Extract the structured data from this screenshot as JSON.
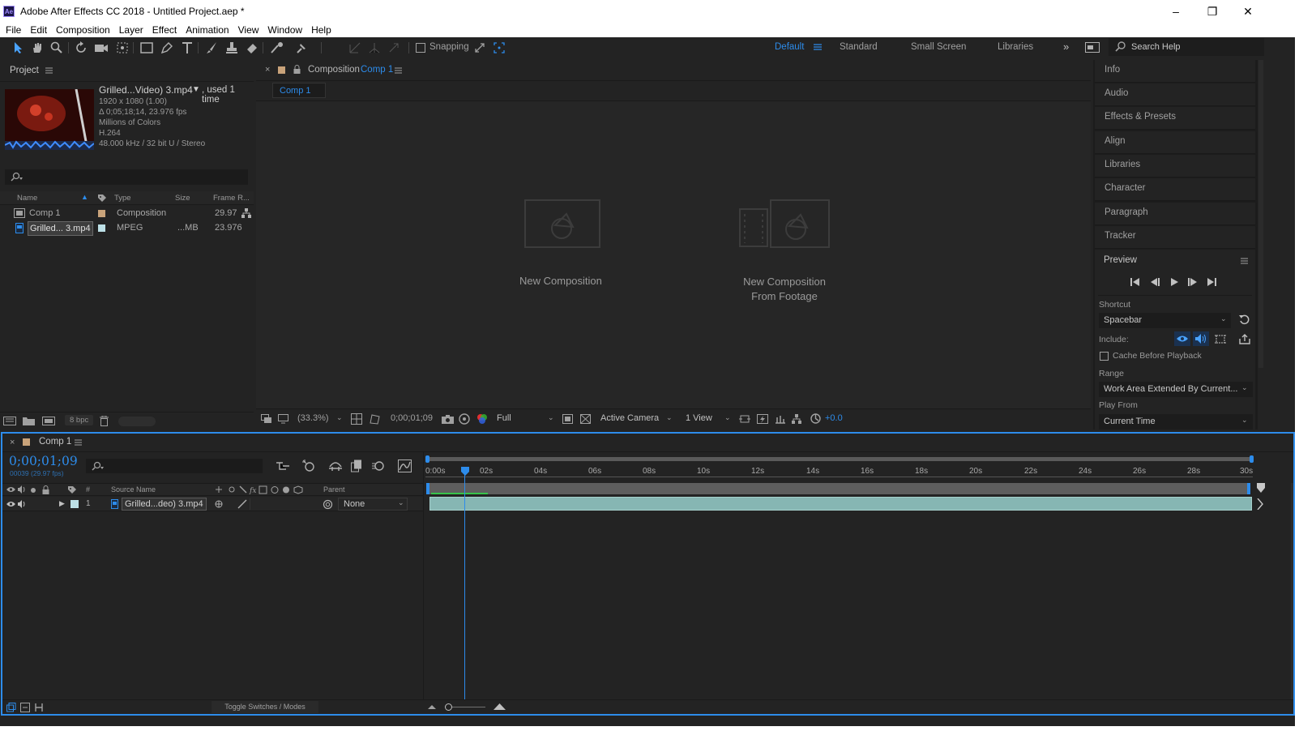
{
  "window": {
    "title": "Adobe After Effects CC 2018 - Untitled Project.aep *",
    "app_badge": "Ae"
  },
  "menu": [
    "File",
    "Edit",
    "Composition",
    "Layer",
    "Effect",
    "Animation",
    "View",
    "Window",
    "Help"
  ],
  "toolbar": {
    "snapping_label": "Snapping",
    "workspaces": [
      "Default",
      "Standard",
      "Small Screen",
      "Libraries"
    ],
    "search_placeholder": "Search Help"
  },
  "project": {
    "tab_label": "Project",
    "footage": {
      "name": "Grilled...Video) 3.mp4",
      "used": ", used 1 time",
      "meta": [
        "1920 x 1080 (1.00)",
        "Δ 0;05;18;14, 23.976 fps",
        "Millions of Colors",
        "H.264",
        "48.000 kHz / 32 bit U / Stereo"
      ]
    },
    "columns": [
      "Name",
      "Type",
      "Size",
      "Frame R..."
    ],
    "items": [
      {
        "name": "Comp 1",
        "type": "Composition",
        "size": "",
        "fps": "29.97"
      },
      {
        "name": "Grilled... 3.mp4",
        "type": "MPEG",
        "size": "...MB",
        "fps": "23.976"
      }
    ],
    "bpc": "8 bpc"
  },
  "viewer": {
    "tab_prefix": "Composition",
    "tab_name": "Comp 1",
    "subtab": "Comp 1",
    "new_comp": "New Composition",
    "new_comp_footage_1": "New Composition",
    "new_comp_footage_2": "From Footage",
    "zoom": "(33.3%)",
    "timecode": "0;00;01;09",
    "resolution": "Full",
    "camera": "Active Camera",
    "views": "1 View",
    "exposure": "+0.0"
  },
  "right_panels": [
    "Info",
    "Audio",
    "Effects & Presets",
    "Align",
    "Libraries",
    "Character",
    "Paragraph",
    "Tracker"
  ],
  "preview": {
    "title": "Preview",
    "shortcut_label": "Shortcut",
    "shortcut_value": "Spacebar",
    "include_label": "Include:",
    "cache_label": "Cache Before Playback",
    "range_label": "Range",
    "range_value": "Work Area Extended By Current...",
    "play_from_label": "Play From",
    "play_from_value": "Current Time"
  },
  "timeline": {
    "tab": "Comp 1",
    "timecode": "0;00;01;09",
    "frame_info": "00039 (29.97 fps)",
    "columns": [
      "#",
      "Source Name",
      "Parent"
    ],
    "layer": {
      "num": "1",
      "name": "Grilled...deo) 3.mp4",
      "parent": "None"
    },
    "ruler": [
      "0:00s",
      "02s",
      "04s",
      "06s",
      "08s",
      "10s",
      "12s",
      "14s",
      "16s",
      "18s",
      "20s",
      "22s",
      "24s",
      "26s",
      "28s",
      "30s"
    ],
    "toggle_label": "Toggle Switches / Modes"
  }
}
